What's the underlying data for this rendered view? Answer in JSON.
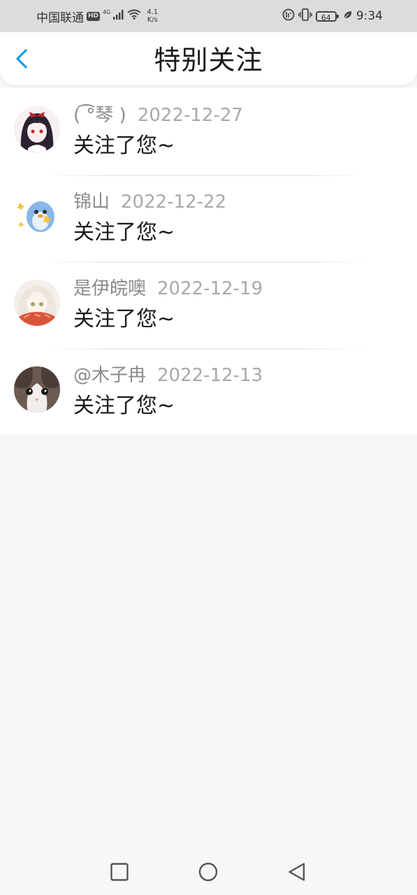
{
  "status_bar": {
    "carrier": "中国联通",
    "hd_badge": "HD",
    "network": "4G",
    "speed_value": "4.1",
    "speed_unit": "K/s",
    "battery": "64",
    "time": "9:34"
  },
  "header": {
    "title": "特别关注",
    "back_icon": "chevron-left-icon",
    "accent_color": "#1a9bf0"
  },
  "list": {
    "items": [
      {
        "name": "( ͡°琴 )",
        "date": "2022-12-27",
        "action": "关注了您~",
        "avatar_icon": "anime-girl-avatar"
      },
      {
        "name": "锦山",
        "date": "2022-12-22",
        "action": "关注了您~",
        "avatar_icon": "cartoon-penguin-avatar"
      },
      {
        "name": "是伊皖噢",
        "date": "2022-12-19",
        "action": "关注了您~",
        "avatar_icon": "anime-girl-scarf-avatar"
      },
      {
        "name": "@木子冉",
        "date": "2022-12-13",
        "action": "关注了您~",
        "avatar_icon": "cat-avatar"
      }
    ]
  },
  "nav_bar": {
    "recents_icon": "square-icon",
    "home_icon": "circle-icon",
    "back_icon": "triangle-back-icon"
  }
}
